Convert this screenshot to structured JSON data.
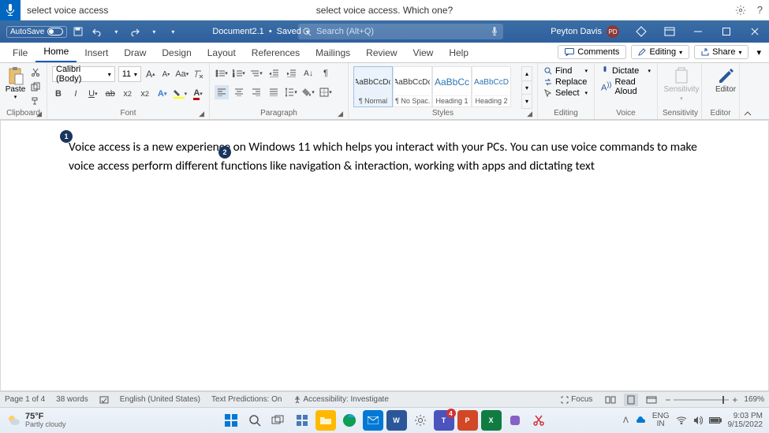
{
  "voice_bar": {
    "input_text": "select voice access",
    "prompt": "select voice access. Which one?"
  },
  "title_bar": {
    "autosave_label": "AutoSave",
    "doc_name": "Document2.1",
    "save_state": "Saved",
    "search_placeholder": "Search (Alt+Q)",
    "user_name": "Peyton Davis",
    "user_initials": "PD"
  },
  "tabs": {
    "items": [
      "File",
      "Home",
      "Insert",
      "Draw",
      "Design",
      "Layout",
      "References",
      "Mailings",
      "Review",
      "View",
      "Help"
    ],
    "active_index": 1,
    "comments": "Comments",
    "editing": "Editing",
    "share": "Share"
  },
  "ribbon": {
    "clipboard": {
      "paste": "Paste",
      "label": "Clipboard"
    },
    "font": {
      "name": "Calibri (Body)",
      "size": "11",
      "label": "Font"
    },
    "paragraph": {
      "label": "Paragraph"
    },
    "styles": {
      "label": "Styles",
      "items": [
        {
          "preview": "AaBbCcDc",
          "name": "¶ Normal"
        },
        {
          "preview": "AaBbCcDc",
          "name": "¶ No Spac..."
        },
        {
          "preview": "AaBbCc",
          "name": "Heading 1"
        },
        {
          "preview": "AaBbCcD",
          "name": "Heading 2"
        }
      ]
    },
    "editing": {
      "find": "Find",
      "replace": "Replace",
      "select": "Select",
      "label": "Editing"
    },
    "voice": {
      "dictate": "Dictate",
      "read_aloud": "Read Aloud",
      "label": "Voice"
    },
    "sensitivity": {
      "btn": "Sensitivity",
      "label": "Sensitivity"
    },
    "editor": {
      "btn": "Editor",
      "label": "Editor"
    }
  },
  "document": {
    "body": "Voice access is a new experience on Windows 11 which helps you interact with your PCs. You can use voice commands to make voice access perform different functions like navigation & interaction, working with apps and dictating text",
    "markers": {
      "m1": "1",
      "m2": "2"
    }
  },
  "status_bar": {
    "page": "Page 1 of 4",
    "words": "38 words",
    "language": "English (United States)",
    "predictions": "Text Predictions: On",
    "accessibility": "Accessibility: Investigate",
    "focus": "Focus",
    "zoom": "169%"
  },
  "taskbar": {
    "temp": "75°F",
    "condition": "Partly cloudy",
    "lang": "ENG",
    "region": "IN",
    "time": "9:03 PM",
    "date": "9/15/2022"
  }
}
